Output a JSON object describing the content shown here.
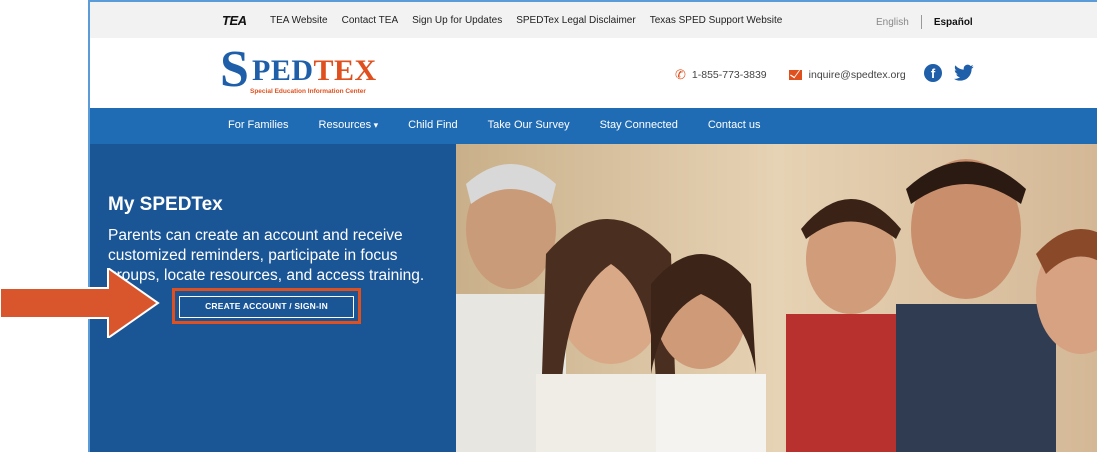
{
  "topbar": {
    "tea_logo": "TEA",
    "links": [
      "TEA Website",
      "Contact TEA",
      "Sign Up for Updates",
      "SPEDTex Legal Disclaimer",
      "Texas SPED Support Website"
    ],
    "lang_en": "English",
    "lang_es": "Español"
  },
  "header": {
    "logo_s": "S",
    "logo_ped": "PED",
    "logo_tex": "TEX",
    "logo_tagline": "Special Education Information Center",
    "phone": "1-855-773-3839",
    "email": "inquire@spedtex.org",
    "social": [
      "facebook-icon",
      "twitter-icon"
    ]
  },
  "nav": {
    "items": [
      "For Families",
      "Resources",
      "Child Find",
      "Take Our Survey",
      "Stay Connected",
      "Contact us"
    ]
  },
  "hero": {
    "title": "My SPEDTex",
    "text": "Parents can create an account and receive customized reminders, participate in focus groups, locate resources, and access training.",
    "cta_label": "CREATE ACCOUNT / SIGN-IN"
  },
  "colors": {
    "brand_blue": "#1f5ea8",
    "nav_blue": "#1f6cb5",
    "hero_blue": "#1a5596",
    "accent_orange": "#e0501e",
    "annotation_arrow": "#d9562c"
  }
}
